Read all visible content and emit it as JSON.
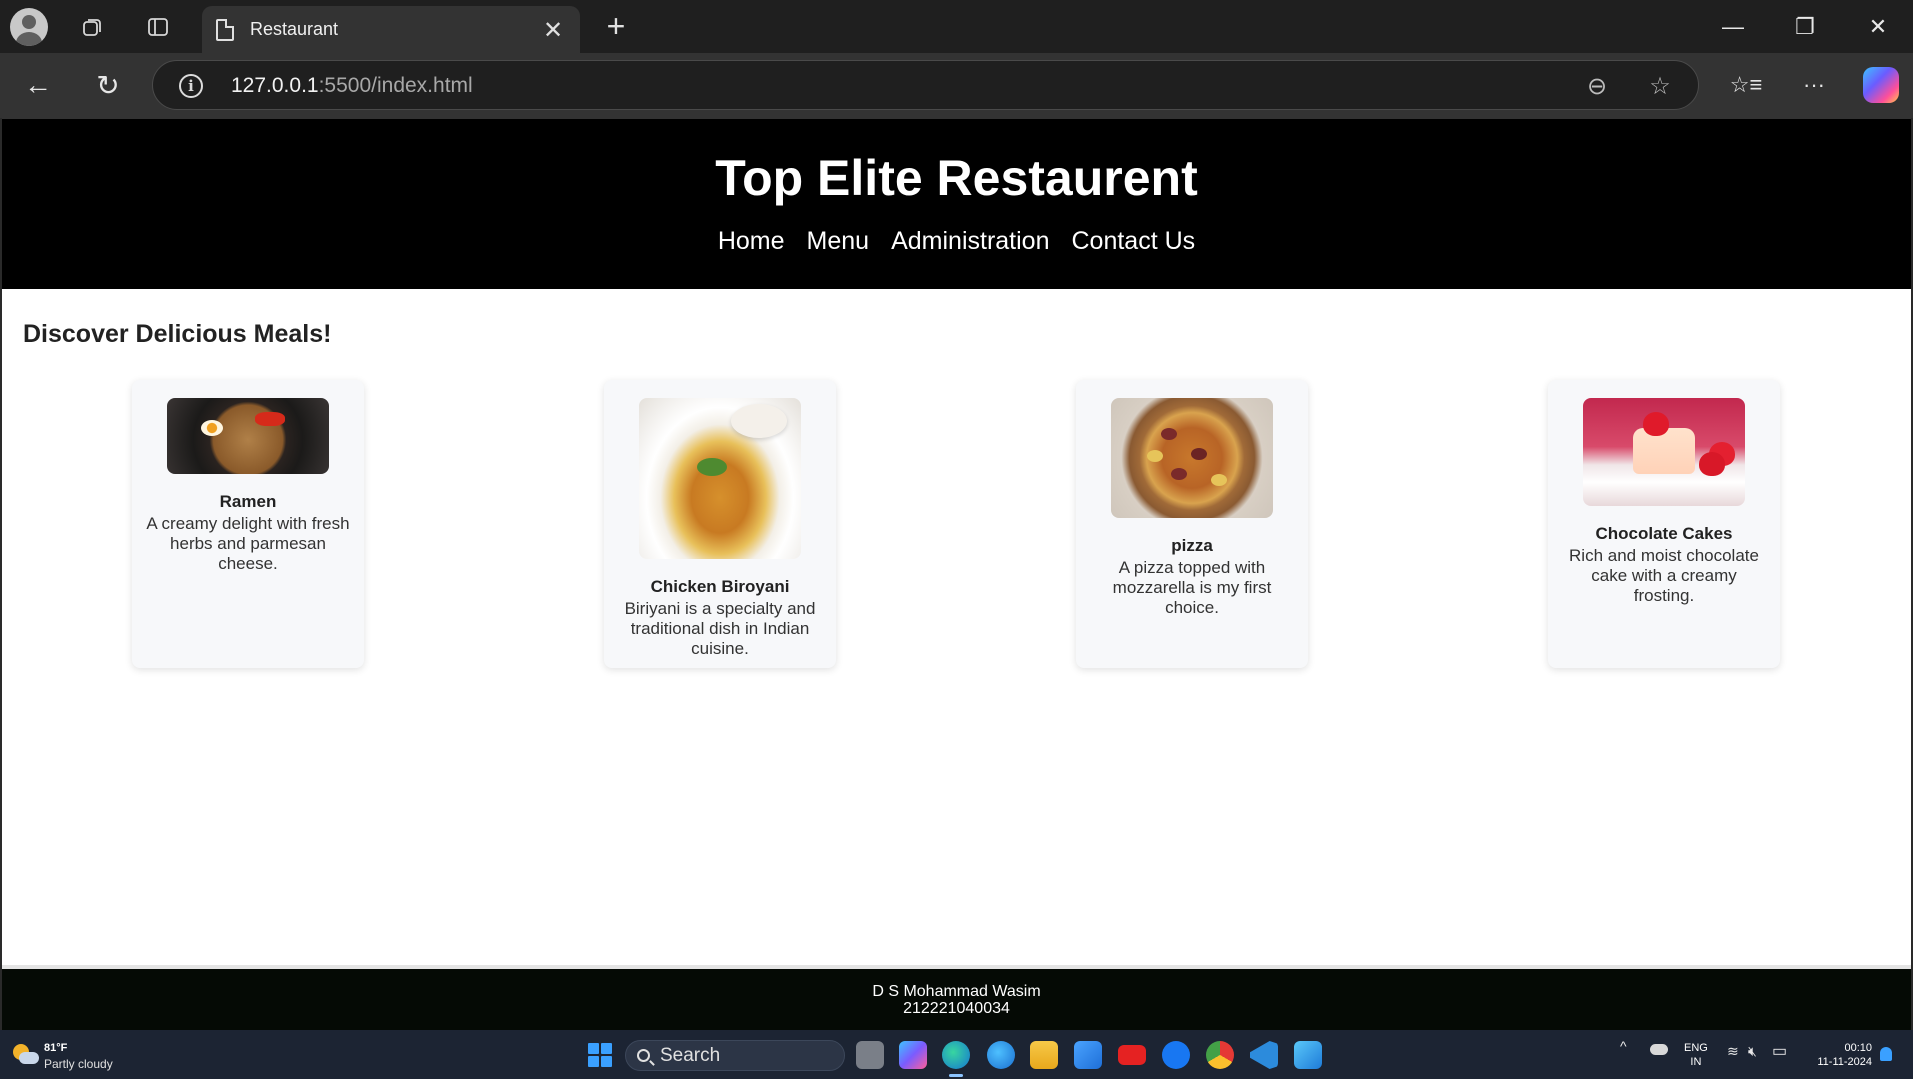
{
  "browser": {
    "tab_title": "Restaurant",
    "url_host": "127.0.0.1",
    "url_rest": ":5500/index.html",
    "icons": [
      "profile-avatar-icon",
      "workspaces-icon",
      "tab-actions-icon",
      "page-icon",
      "close-icon",
      "plus-icon",
      "minimize-icon",
      "restore-icon",
      "close-window-icon",
      "back-icon",
      "refresh-icon",
      "info-icon",
      "zoom-out-icon",
      "star-icon",
      "favorites-icon",
      "more-icon",
      "copilot-icon"
    ],
    "glyphs": {
      "close": "✕",
      "plus": "+",
      "minimize": "—",
      "restore": "❐",
      "back": "←",
      "refresh": "↻",
      "info": "i",
      "zoom_out": "⊖",
      "star": "☆",
      "favorites": "☆≡",
      "more": "···"
    }
  },
  "site": {
    "title": "Top Elite Restaurent",
    "nav": [
      "Home",
      "Menu",
      "Administration",
      "Contact Us"
    ],
    "section_title": "Discover Delicious Meals!",
    "cards": [
      {
        "name": "Ramen",
        "description": "A creamy delight with fresh herbs and parmesan cheese."
      },
      {
        "name": "Chicken Biroyani",
        "description": "Biriyani is a specialty and traditional dish in Indian cuisine."
      },
      {
        "name": "pizza",
        "description": "A pizza topped with mozzarella is my first choice."
      },
      {
        "name": "Chocolate Cakes",
        "description": "Rich and moist chocolate cake with a creamy frosting."
      }
    ],
    "footer": {
      "name": "D S Mohammad Wasim",
      "id": "212221040034"
    }
  },
  "taskbar": {
    "weather_temp": "81°F",
    "weather_desc": "Partly cloudy",
    "search_label": "Search",
    "lang_top": "ENG",
    "lang_bottom": "IN",
    "time": "00:10",
    "date": "11-11-2024",
    "tray_chevron": "^",
    "tray_wifi": "≋",
    "tray_volume": "🔇︎",
    "tray_battery": "▭",
    "app_icons": [
      "file-explorer-icon",
      "copilot-app-icon",
      "edge-icon",
      "edge-beta-icon",
      "folder-icon",
      "store-icon",
      "youtube-icon",
      "facebook-icon",
      "chrome-icon",
      "vscode-icon",
      "drawing-app-icon"
    ]
  },
  "colors": {
    "header_bg": "#000000",
    "footer_bg": "#050a05",
    "card_bg": "#f7f8fa",
    "taskbar_bg": "#1c2433"
  }
}
